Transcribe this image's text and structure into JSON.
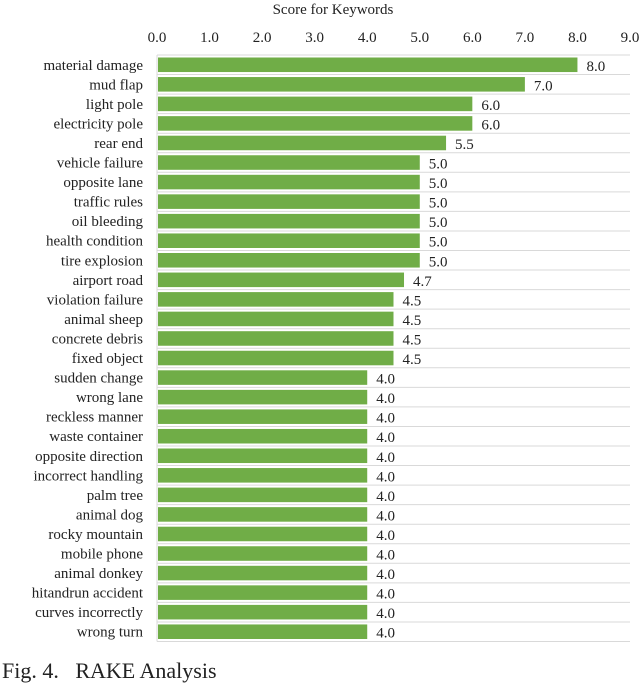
{
  "chart_data": {
    "type": "bar",
    "orientation": "horizontal",
    "title": "Score for Keywords",
    "xlabel": "Score for Keywords",
    "ylabel": "",
    "xlim": [
      0,
      9
    ],
    "x_ticks": [
      "0.0",
      "1.0",
      "2.0",
      "3.0",
      "4.0",
      "5.0",
      "6.0",
      "7.0",
      "8.0",
      "9.0"
    ],
    "x_axis_position": "top",
    "grid": true,
    "legend": "none",
    "bar_color": "#70ad47",
    "categories": [
      "material damage",
      "mud flap",
      "light pole",
      "electricity pole",
      "rear end",
      "vehicle failure",
      "opposite lane",
      "traffic rules",
      "oil bleeding",
      "health condition",
      "tire explosion",
      "airport road",
      "violation failure",
      "animal sheep",
      "concrete debris",
      "fixed object",
      "sudden change",
      "wrong lane",
      "reckless manner",
      "waste container",
      "opposite direction",
      "incorrect handling",
      "palm tree",
      "animal dog",
      "rocky mountain",
      "mobile phone",
      "animal donkey",
      "hitandrun accident",
      "curves incorrectly",
      "wrong turn"
    ],
    "values": [
      8.0,
      7.0,
      6.0,
      6.0,
      5.5,
      5.0,
      5.0,
      5.0,
      5.0,
      5.0,
      5.0,
      4.7,
      4.5,
      4.5,
      4.5,
      4.5,
      4.0,
      4.0,
      4.0,
      4.0,
      4.0,
      4.0,
      4.0,
      4.0,
      4.0,
      4.0,
      4.0,
      4.0,
      4.0,
      4.0
    ],
    "value_labels": [
      "8.0",
      "7.0",
      "6.0",
      "6.0",
      "5.5",
      "5.0",
      "5.0",
      "5.0",
      "5.0",
      "5.0",
      "5.0",
      "4.7",
      "4.5",
      "4.5",
      "4.5",
      "4.5",
      "4.0",
      "4.0",
      "4.0",
      "4.0",
      "4.0",
      "4.0",
      "4.0",
      "4.0",
      "4.0",
      "4.0",
      "4.0",
      "4.0",
      "4.0",
      "4.0"
    ]
  },
  "caption": "Fig. 4.   RAKE Analysis"
}
